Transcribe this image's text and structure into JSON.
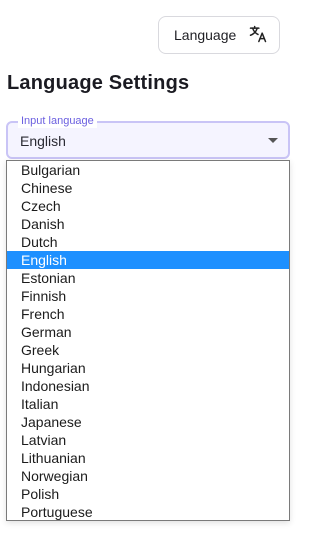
{
  "header": {
    "language_button_label": "Language"
  },
  "page": {
    "title": "Language Settings"
  },
  "language_field": {
    "label": "Input language",
    "value": "English"
  },
  "dropdown": {
    "selected": "English",
    "options": [
      "Bulgarian",
      "Chinese",
      "Czech",
      "Danish",
      "Dutch",
      "English",
      "Estonian",
      "Finnish",
      "French",
      "German",
      "Greek",
      "Hungarian",
      "Indonesian",
      "Italian",
      "Japanese",
      "Latvian",
      "Lithuanian",
      "Norwegian",
      "Polish",
      "Portuguese"
    ]
  },
  "colors": {
    "selected_option": "#1e90ff",
    "field_border": "#c9c4f6",
    "field_label": "#6b5fe0"
  }
}
